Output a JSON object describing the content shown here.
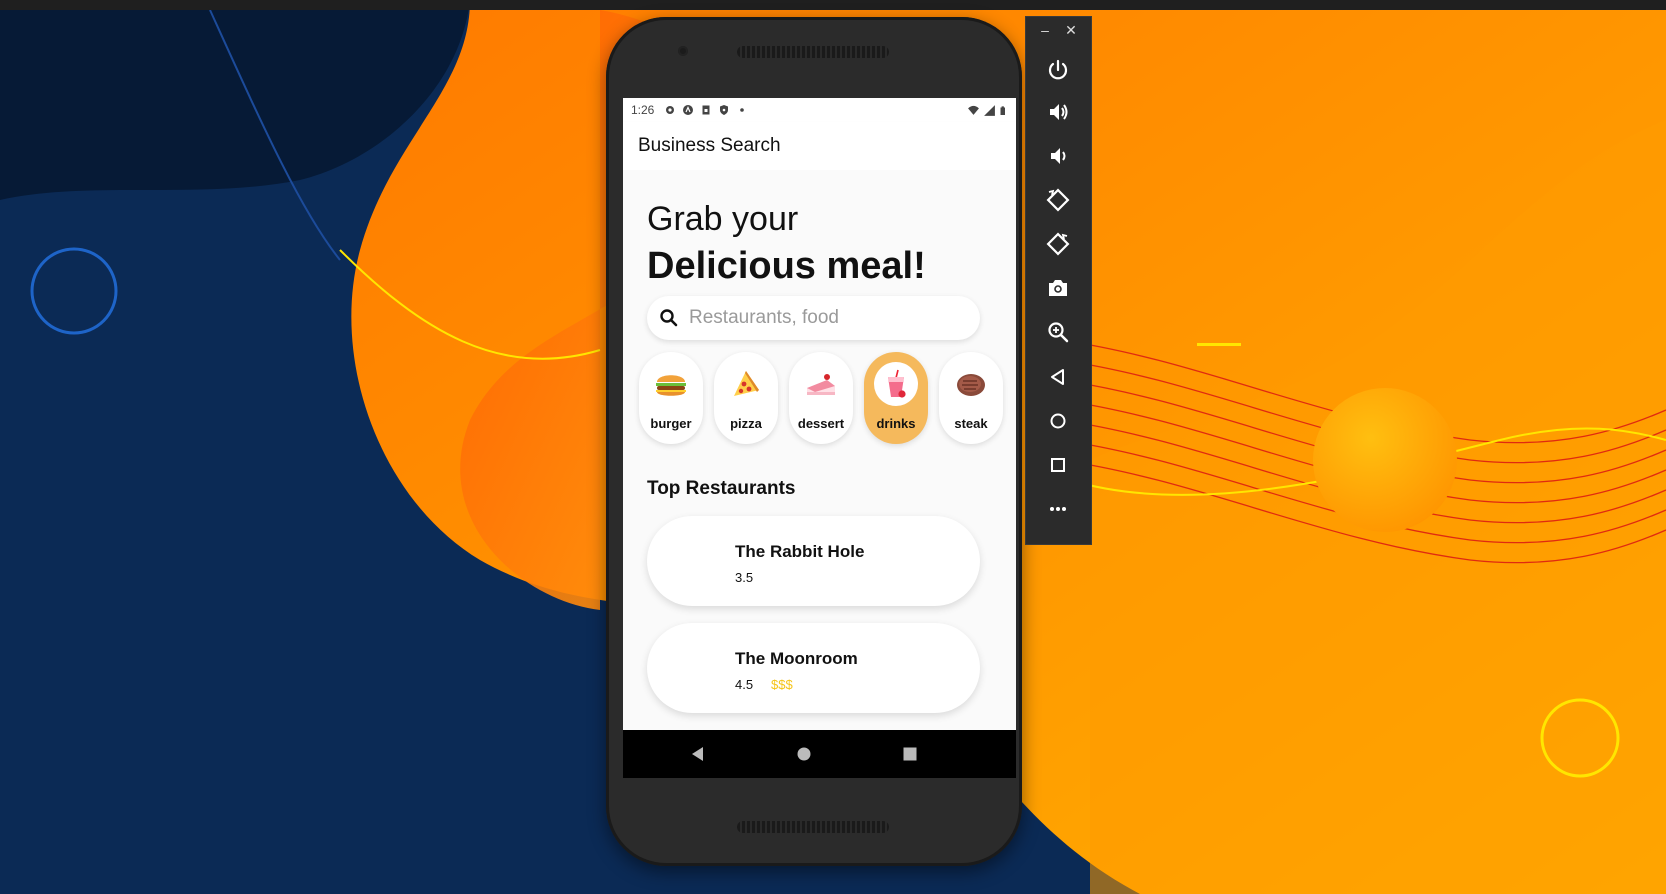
{
  "phone_app": {
    "status_bar": {
      "time": "1:26"
    },
    "app_bar": {
      "title": "Business Search"
    },
    "greeting": {
      "line1": "Grab your",
      "line2": "Delicious meal!"
    },
    "search": {
      "placeholder": "Restaurants, food"
    },
    "categories": [
      {
        "label": "burger",
        "icon": "burger-icon",
        "selected": false
      },
      {
        "label": "pizza",
        "icon": "pizza-icon",
        "selected": false
      },
      {
        "label": "dessert",
        "icon": "cake-icon",
        "selected": false
      },
      {
        "label": "drinks",
        "icon": "drink-icon",
        "selected": true
      },
      {
        "label": "steak",
        "icon": "steak-icon",
        "selected": false
      }
    ],
    "section_title": "Top Restaurants",
    "restaurants": [
      {
        "name": "The Rabbit Hole",
        "rating": "3.5",
        "price": ""
      },
      {
        "name": "The Moonroom",
        "rating": "4.5",
        "price": "$$$"
      }
    ]
  },
  "emulator_toolbar": {
    "window_controls": [
      "minimize-icon",
      "close-icon"
    ],
    "tools": [
      "power-icon",
      "volume-up-icon",
      "volume-down-icon",
      "rotate-left-icon",
      "rotate-right-icon",
      "camera-icon",
      "zoom-icon",
      "back-icon",
      "home-icon",
      "overview-icon",
      "more-icon"
    ]
  },
  "colors": {
    "accent": "#f5b95c",
    "price": "#f5c518",
    "background_orange": "#ff9a0d",
    "background_navy": "#0b2a55"
  }
}
